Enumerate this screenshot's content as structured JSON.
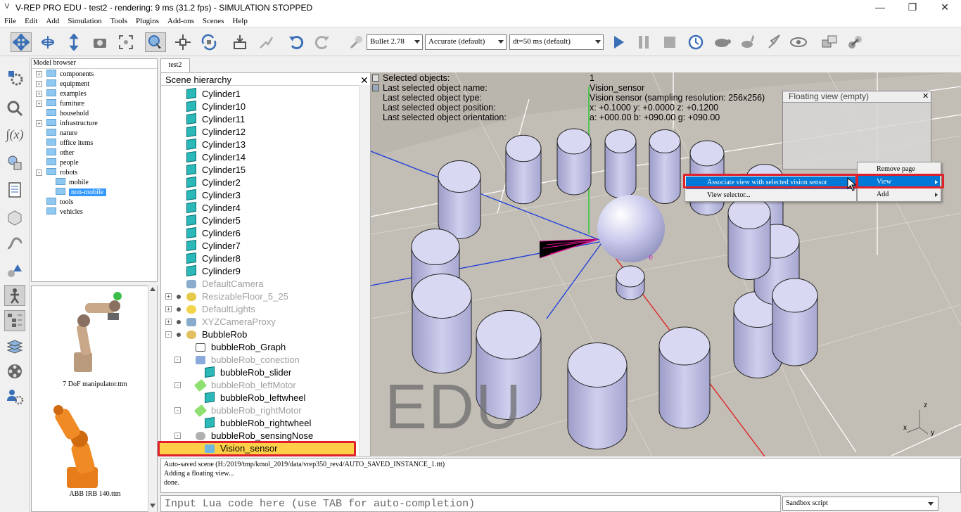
{
  "window": {
    "title": "V-REP PRO EDU - test2 - rendering: 9 ms (31.2 fps) - SIMULATION STOPPED"
  },
  "menu": [
    "File",
    "Edit",
    "Add",
    "Simulation",
    "Tools",
    "Plugins",
    "Add-ons",
    "Scenes",
    "Help"
  ],
  "toolbar": {
    "engine": "Bullet 2.78",
    "accuracy": "Accurate (default)",
    "dt": "dt=50 ms (default)"
  },
  "model_browser": {
    "title": "Model browser",
    "items": [
      {
        "label": "components",
        "expand": "+",
        "indent": 0
      },
      {
        "label": "equipment",
        "expand": "+",
        "indent": 0
      },
      {
        "label": "examples",
        "expand": "+",
        "indent": 0
      },
      {
        "label": "furniture",
        "expand": "+",
        "indent": 0
      },
      {
        "label": "household",
        "expand": "",
        "indent": 0
      },
      {
        "label": "infrastructure",
        "expand": "+",
        "indent": 0
      },
      {
        "label": "nature",
        "expand": "",
        "indent": 0
      },
      {
        "label": "office items",
        "expand": "",
        "indent": 0
      },
      {
        "label": "other",
        "expand": "",
        "indent": 0
      },
      {
        "label": "people",
        "expand": "",
        "indent": 0
      },
      {
        "label": "robots",
        "expand": "-",
        "indent": 0
      },
      {
        "label": "mobile",
        "expand": "",
        "indent": 1
      },
      {
        "label": "non-mobile",
        "expand": "",
        "indent": 1,
        "selected": true
      },
      {
        "label": "tools",
        "expand": "",
        "indent": 0
      },
      {
        "label": "vehicles",
        "expand": "",
        "indent": 0
      }
    ],
    "thumbnails": [
      "7 DoF manipulator.ttm",
      "ABB IRB 140.ttm"
    ]
  },
  "tab": "test2",
  "hierarchy": {
    "title": "Scene hierarchy",
    "items": [
      {
        "label": "Cylinder1",
        "icon": "cube",
        "indent": 0
      },
      {
        "label": "Cylinder10",
        "icon": "cube",
        "indent": 0
      },
      {
        "label": "Cylinder11",
        "icon": "cube",
        "indent": 0
      },
      {
        "label": "Cylinder12",
        "icon": "cube",
        "indent": 0
      },
      {
        "label": "Cylinder13",
        "icon": "cube",
        "indent": 0
      },
      {
        "label": "Cylinder14",
        "icon": "cube",
        "indent": 0
      },
      {
        "label": "Cylinder15",
        "icon": "cube",
        "indent": 0
      },
      {
        "label": "Cylinder2",
        "icon": "cube",
        "indent": 0
      },
      {
        "label": "Cylinder3",
        "icon": "cube",
        "indent": 0
      },
      {
        "label": "Cylinder4",
        "icon": "cube",
        "indent": 0
      },
      {
        "label": "Cylinder5",
        "icon": "cube",
        "indent": 0
      },
      {
        "label": "Cylinder6",
        "icon": "cube",
        "indent": 0
      },
      {
        "label": "Cylinder7",
        "icon": "cube",
        "indent": 0
      },
      {
        "label": "Cylinder8",
        "icon": "cube",
        "indent": 0
      },
      {
        "label": "Cylinder9",
        "icon": "cube",
        "indent": 0
      },
      {
        "label": "DefaultCamera",
        "icon": "camera",
        "indent": 0,
        "dim": true
      },
      {
        "label": "ResizableFloor_5_25",
        "icon": "floor",
        "indent": 0,
        "dim": true,
        "expand": "+"
      },
      {
        "label": "DefaultLights",
        "icon": "light",
        "indent": 0,
        "dim": true,
        "expand": "+"
      },
      {
        "label": "XYZCameraProxy",
        "icon": "camera",
        "indent": 0,
        "dim": true,
        "expand": "+"
      },
      {
        "label": "BubbleRob",
        "icon": "robot",
        "indent": 0,
        "expand": "-"
      },
      {
        "label": "bubbleRob_Graph",
        "icon": "graph",
        "indent": 1
      },
      {
        "label": "bubbleRob_conection",
        "icon": "joint",
        "indent": 1,
        "dim": true,
        "expand": "-"
      },
      {
        "label": "bubbleRob_slider",
        "icon": "cube",
        "indent": 2
      },
      {
        "label": "bubbleRob_leftMotor",
        "icon": "motor",
        "indent": 1,
        "dim": true,
        "expand": "-"
      },
      {
        "label": "bubbleRob_leftwheel",
        "icon": "cube",
        "indent": 2
      },
      {
        "label": "bubbleRob_rightMotor",
        "icon": "motor",
        "indent": 1,
        "dim": true,
        "expand": "-"
      },
      {
        "label": "bubbleRob_rightwheel",
        "icon": "cube",
        "indent": 2
      },
      {
        "label": "bubbleRob_sensingNose",
        "icon": "sensor",
        "indent": 1,
        "expand": "-"
      },
      {
        "label": "Vision_sensor",
        "icon": "vision",
        "indent": 2,
        "selected": true
      }
    ]
  },
  "viewport": {
    "info_labels": [
      "Selected objects:",
      "Last selected object name:",
      "Last selected object type:",
      "Last selected object position:",
      "Last selected object orientation:"
    ],
    "info_values": [
      "1",
      "Vision_sensor",
      "Vision sensor (sampling resolution: 256x256)",
      "x: +0.1000    y: +0.0000    z: +0.1200",
      "a: +000.00    b: +090.00    g: +090.00"
    ],
    "watermark": "EDU",
    "floating_view_title": "Floating view (empty)",
    "axis_labels": {
      "x": "x",
      "y": "y",
      "z": "z"
    }
  },
  "context_menu": {
    "main": [
      "Associate view with selected vision sensor",
      "View selector..."
    ],
    "side": [
      "Remove page",
      "View",
      "Add"
    ]
  },
  "console": {
    "lines": [
      "Auto-saved scene (H:/2019/tmp/kmol_2019/data/vrep350_rev4/AUTO_SAVED_INSTANCE_1.ttt)",
      "Adding a floating view...",
      "done."
    ],
    "input_placeholder": "Input Lua code here (use TAB for auto-completion)",
    "script_mode": "Sandbox script"
  }
}
